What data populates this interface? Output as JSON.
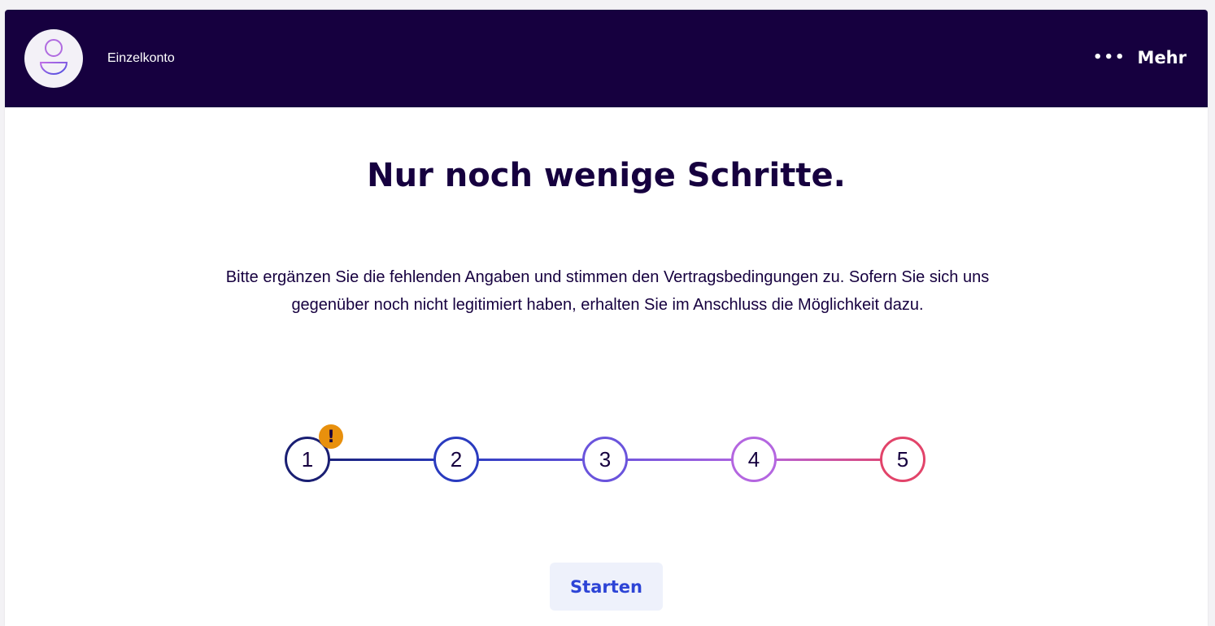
{
  "header": {
    "account_name": "Einzelkonto",
    "avatar_icon": "user-icon",
    "more_icon": "more-dots-icon",
    "more_dots": "•••",
    "more_label": "Mehr",
    "background_color": "#16003f"
  },
  "main": {
    "title": "Nur noch wenige Schritte.",
    "description": "Bitte ergänzen Sie die fehlenden Angaben und stimmen den Vertragsbedingungen zu. Sofern Sie sich uns gegenüber noch nicht legitimiert haben, erhalten Sie im Anschluss die Möglichkeit dazu.",
    "steps": [
      {
        "label": "1",
        "color": "#1a1f73",
        "warning": "!"
      },
      {
        "label": "2",
        "color": "#2a3bbf"
      },
      {
        "label": "3",
        "color": "#6a54dc"
      },
      {
        "label": "4",
        "color": "#b466e0"
      },
      {
        "label": "5",
        "color": "#e2446a"
      }
    ],
    "warning_color": "#e8900d",
    "start_button": "Starten"
  }
}
